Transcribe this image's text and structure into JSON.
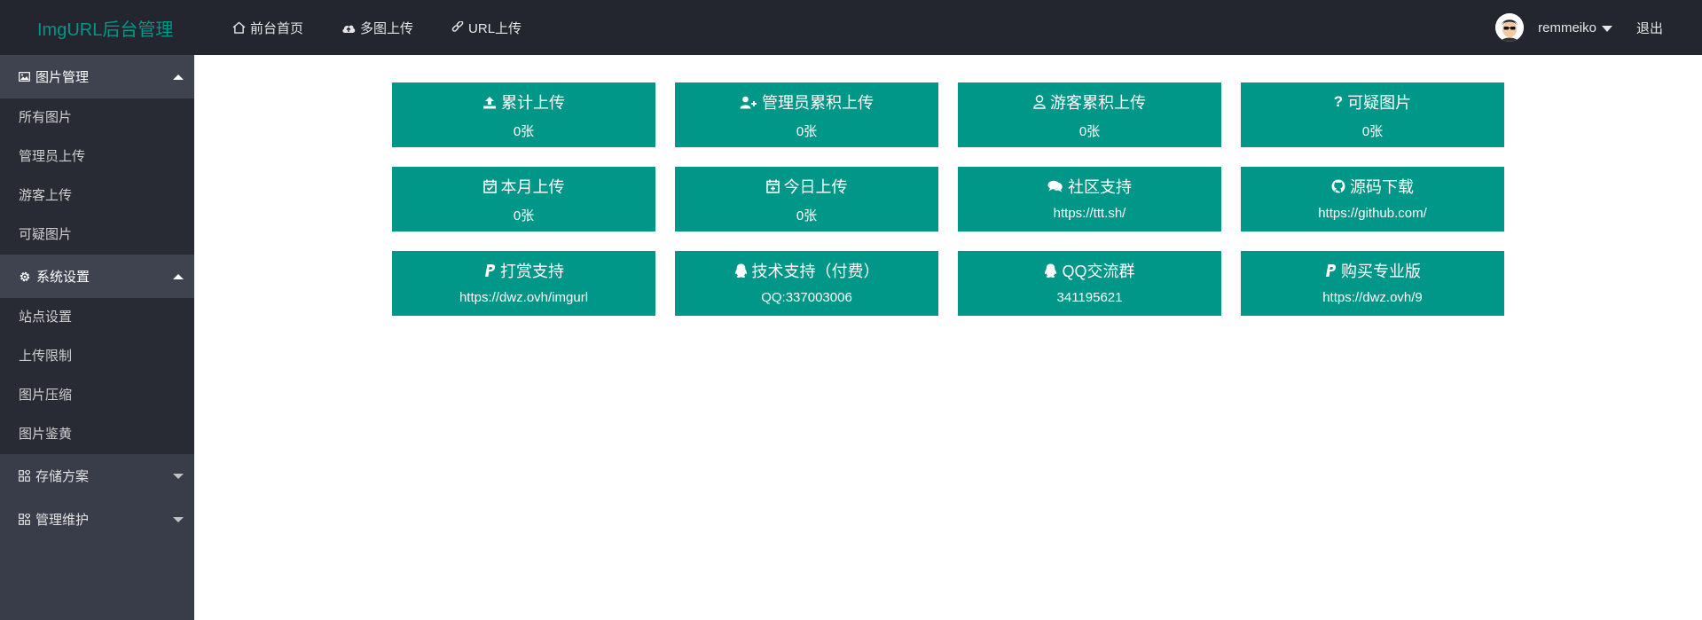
{
  "header": {
    "logo": "ImgURL后台管理",
    "nav": [
      {
        "label": "前台首页",
        "icon": "home-icon"
      },
      {
        "label": "多图上传",
        "icon": "cloud-upload-icon"
      },
      {
        "label": "URL上传",
        "icon": "link-icon"
      }
    ],
    "username": "remmeiko",
    "logout": "退出"
  },
  "sidebar": {
    "groups": [
      {
        "label": "图片管理",
        "icon": "image-icon",
        "open": true,
        "items": [
          "所有图片",
          "管理员上传",
          "游客上传",
          "可疑图片"
        ]
      },
      {
        "label": "系统设置",
        "icon": "gear-icon",
        "open": true,
        "items": [
          "站点设置",
          "上传限制",
          "图片压缩",
          "图片鉴黄"
        ]
      },
      {
        "label": "存储方案",
        "icon": "apps-icon",
        "open": false,
        "items": []
      },
      {
        "label": "管理维护",
        "icon": "apps-icon",
        "open": false,
        "items": []
      }
    ]
  },
  "cards": [
    {
      "title": "累计上传",
      "value": "0张",
      "icon": "upload-icon"
    },
    {
      "title": "管理员累积上传",
      "value": "0张",
      "icon": "user-plus-icon"
    },
    {
      "title": "游客累积上传",
      "value": "0张",
      "icon": "user-icon"
    },
    {
      "title": "可疑图片",
      "value": "0张",
      "icon": "question-icon"
    },
    {
      "title": "本月上传",
      "value": "0张",
      "icon": "calendar-check-icon"
    },
    {
      "title": "今日上传",
      "value": "0张",
      "icon": "calendar-plus-icon"
    },
    {
      "title": "社区支持",
      "value": "https://ttt.sh/",
      "icon": "comments-icon"
    },
    {
      "title": "源码下载",
      "value": "https://github.com/",
      "icon": "github-icon"
    },
    {
      "title": "打赏支持",
      "value": "https://dwz.ovh/imgurl",
      "icon": "paypal-icon"
    },
    {
      "title": "技术支持（付费）",
      "value": "QQ:337003006",
      "icon": "qq-icon"
    },
    {
      "title": "QQ交流群",
      "value": "341195621",
      "icon": "qq-icon"
    },
    {
      "title": "购买专业版",
      "value": "https://dwz.ovh/9",
      "icon": "paypal-icon"
    }
  ],
  "colors": {
    "header_bg": "#23262e",
    "sidebar_bg": "#393d49",
    "accent": "#009688"
  }
}
